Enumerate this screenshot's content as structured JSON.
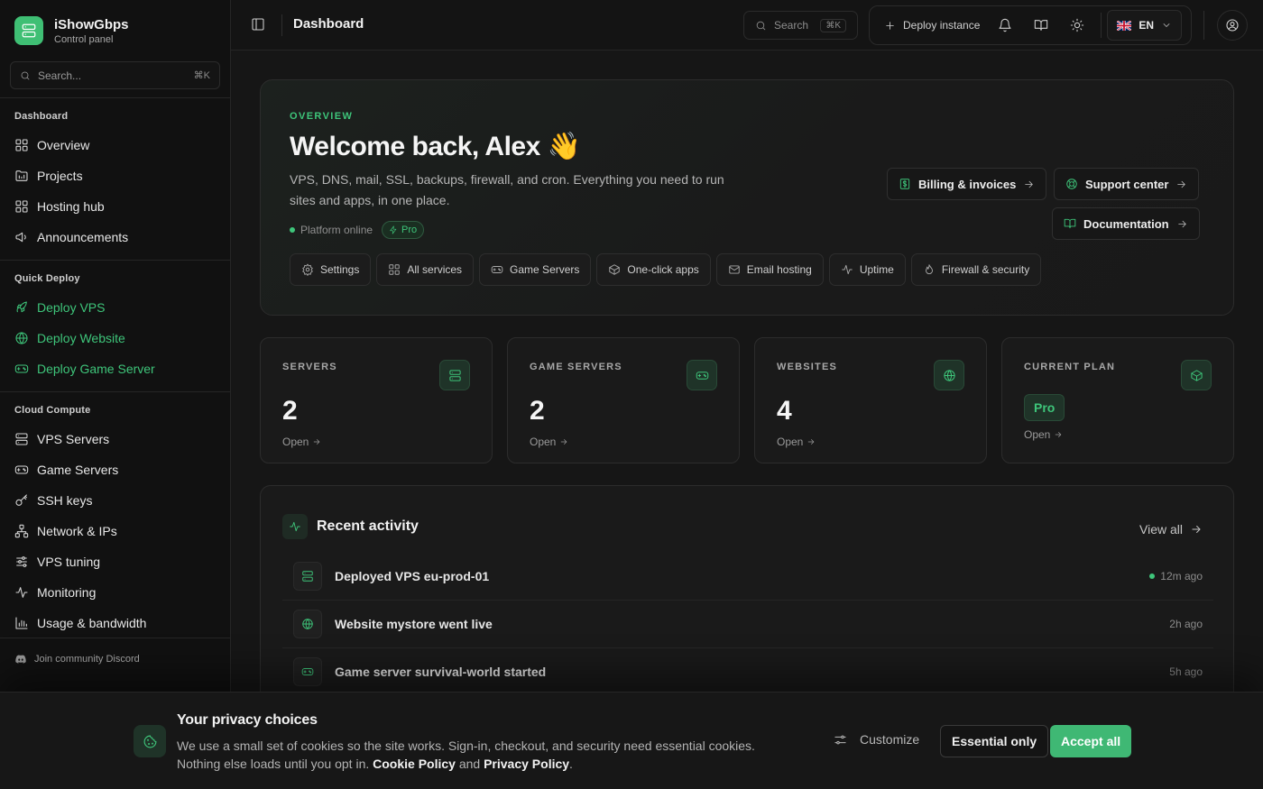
{
  "app": {
    "name": "iShowGbps",
    "subtitle": "Control panel"
  },
  "colors": {
    "accent": "#3ec57a",
    "background": "#161616",
    "sidebar": "#111111"
  },
  "sidebar": {
    "search": {
      "placeholder": "Search...",
      "shortcut": "⌘K"
    },
    "sections": [
      {
        "title": "Dashboard",
        "items": [
          {
            "label": "Overview",
            "icon": "grid-icon"
          },
          {
            "label": "Projects",
            "icon": "folder-icon"
          },
          {
            "label": "Hosting hub",
            "icon": "grid-icon"
          },
          {
            "label": "Announcements",
            "icon": "megaphone-icon"
          }
        ]
      },
      {
        "title": "Quick Deploy",
        "items": [
          {
            "label": "Deploy VPS",
            "icon": "rocket-icon"
          },
          {
            "label": "Deploy Website",
            "icon": "globe-icon"
          },
          {
            "label": "Deploy Game Server",
            "icon": "gamepad-icon"
          }
        ]
      },
      {
        "title": "Cloud Compute",
        "items": [
          {
            "label": "VPS Servers",
            "icon": "server-icon"
          },
          {
            "label": "Game Servers",
            "icon": "gamepad-icon"
          },
          {
            "label": "SSH keys",
            "icon": "key-icon"
          },
          {
            "label": "Network & IPs",
            "icon": "network-icon"
          },
          {
            "label": "VPS tuning",
            "icon": "sliders-icon"
          },
          {
            "label": "Monitoring",
            "icon": "activity-icon"
          },
          {
            "label": "Usage & bandwidth",
            "icon": "bar-chart-icon"
          }
        ]
      }
    ],
    "footer": {
      "discord": "Join community Discord"
    }
  },
  "topbar": {
    "title": "Dashboard",
    "search": {
      "label": "Search",
      "shortcut": "⌘K"
    },
    "deploy": "Deploy instance",
    "language": "EN"
  },
  "hero": {
    "eyebrow": "OVERVIEW",
    "title": "Welcome back, Alex 👋",
    "description": "VPS, DNS, mail, SSL, backups, firewall, and cron. Everything you need to run sites and apps, in one place.",
    "status": "Platform online",
    "plan_badge": "Pro",
    "shortcuts": [
      {
        "label": "Settings",
        "icon": "gear-icon"
      },
      {
        "label": "All services",
        "icon": "grid-icon"
      },
      {
        "label": "Game Servers",
        "icon": "gamepad-icon"
      },
      {
        "label": "One-click apps",
        "icon": "box-icon"
      },
      {
        "label": "Email hosting",
        "icon": "mail-icon"
      },
      {
        "label": "Uptime",
        "icon": "activity-icon"
      },
      {
        "label": "Firewall & security",
        "icon": "flame-icon"
      }
    ],
    "buttons": {
      "billing": "Billing & invoices",
      "support": "Support center",
      "docs": "Documentation"
    }
  },
  "stats": [
    {
      "label": "SERVERS",
      "value": "2",
      "link": "Open",
      "icon": "server-icon"
    },
    {
      "label": "GAME SERVERS",
      "value": "2",
      "link": "Open",
      "icon": "gamepad-icon"
    },
    {
      "label": "WEBSITES",
      "value": "4",
      "link": "Open",
      "icon": "globe-icon"
    },
    {
      "label": "CURRENT PLAN",
      "value": "Pro",
      "link": "Open",
      "icon": "box-icon"
    }
  ],
  "activity": {
    "title": "Recent activity",
    "view_all": "View all",
    "items": [
      {
        "text": "Deployed VPS eu-prod-01",
        "time": "12m ago",
        "icon": "server-icon",
        "live": true
      },
      {
        "text": "Website mystore went live",
        "time": "2h ago",
        "icon": "globe-icon",
        "live": false
      },
      {
        "text": "Game server survival-world started",
        "time": "5h ago",
        "icon": "gamepad-icon",
        "live": false
      }
    ]
  },
  "cookie": {
    "title": "Your privacy choices",
    "text_1": "We use a small set of cookies so the site works. Sign-in, checkout, and security need essential cookies. Nothing else loads until you opt in.",
    "cookie_policy": "Cookie Policy",
    "and": "and",
    "privacy_policy": "Privacy Policy",
    "period": ".",
    "customize": "Customize",
    "essential": "Essential only",
    "accept": "Accept all"
  }
}
